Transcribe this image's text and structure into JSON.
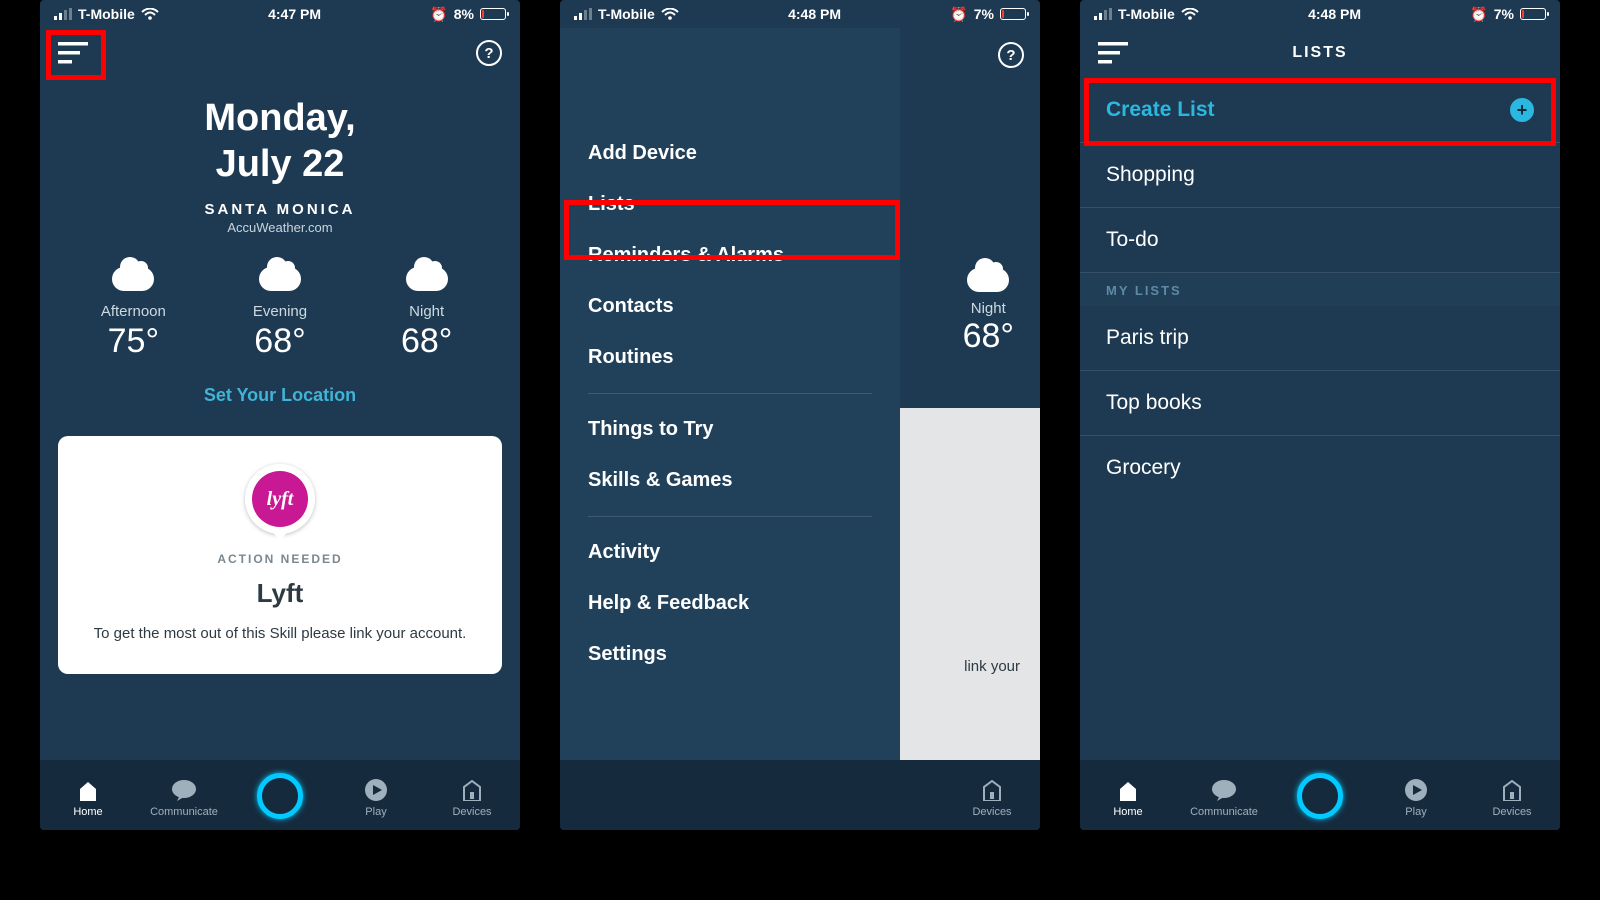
{
  "status": {
    "carrier": "T-Mobile",
    "time1": "4:47 PM",
    "time2": "4:48 PM",
    "time3": "4:48 PM",
    "battery1": "8%",
    "battery2": "7%",
    "battery3": "7%"
  },
  "screen1": {
    "date_line1": "Monday,",
    "date_line2": "July 22",
    "city": "SANTA MONICA",
    "source": "AccuWeather.com",
    "forecast": [
      {
        "label": "Afternoon",
        "temp": "75°"
      },
      {
        "label": "Evening",
        "temp": "68°"
      },
      {
        "label": "Night",
        "temp": "68°"
      }
    ],
    "set_location": "Set Your Location",
    "card": {
      "action_needed": "ACTION NEEDED",
      "lyft_logo_text": "lyft",
      "title": "Lyft",
      "desc": "To get the most out of this Skill please link your account."
    }
  },
  "drawer": {
    "items_top": [
      "Add Device",
      "Lists",
      "Reminders & Alarms",
      "Contacts",
      "Routines"
    ],
    "items_mid": [
      "Things to Try",
      "Skills & Games"
    ],
    "items_bot": [
      "Activity",
      "Help & Feedback",
      "Settings"
    ]
  },
  "bg_weather": {
    "label": "Night",
    "temp": "68°",
    "card_text": "link your"
  },
  "lists": {
    "header": "LISTS",
    "create": "Create List",
    "builtin": [
      "Shopping",
      "To-do"
    ],
    "section": "MY LISTS",
    "user": [
      "Paris trip",
      "Top books",
      "Grocery"
    ]
  },
  "tabs": [
    "Home",
    "Communicate",
    "",
    "Play",
    "Devices"
  ]
}
